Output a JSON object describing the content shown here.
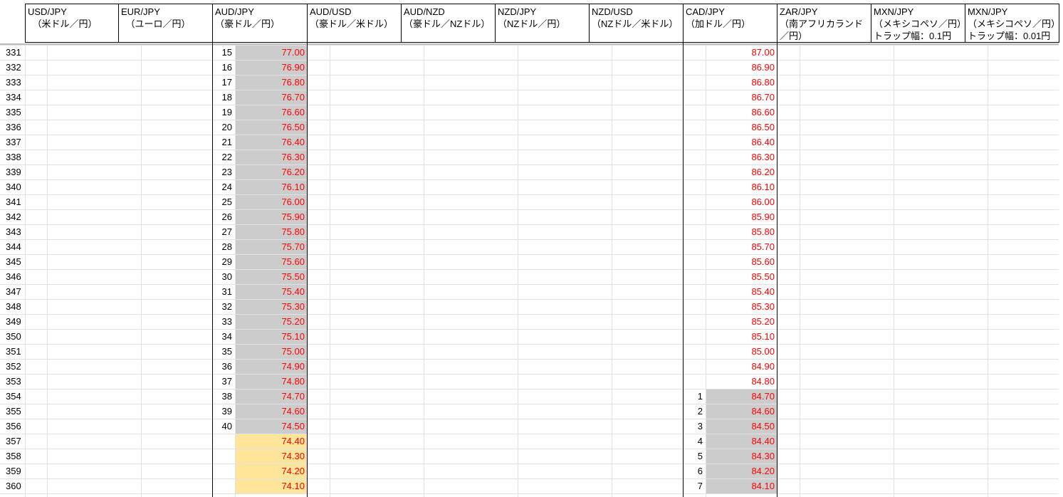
{
  "colors": {
    "price_text": "#ff0000",
    "fill_gray": "#cccccc",
    "fill_yellow": "#ffe599"
  },
  "headers": [
    {
      "line1": "USD/JPY",
      "line2": "　（米ドル／円）",
      "line3": ""
    },
    {
      "line1": "EUR/JPY",
      "line2": "　（ユーロ／円）",
      "line3": ""
    },
    {
      "line1": "AUD/JPY",
      "line2": "（豪ドル／円）",
      "line3": ""
    },
    {
      "line1": "AUD/USD",
      "line2": "（豪ドル／米ドル）",
      "line3": ""
    },
    {
      "line1": "AUD/NZD",
      "line2": "（豪ドル／NZドル）",
      "line3": ""
    },
    {
      "line1": "NZD/JPY",
      "line2": "（NZドル／円）",
      "line3": ""
    },
    {
      "line1": "NZD/USD",
      "line2": "（NZドル／米ドル）",
      "line3": ""
    },
    {
      "line1": "CAD/JPY",
      "line2": "（加ドル／円）",
      "line3": ""
    },
    {
      "line1": "ZAR/JPY",
      "line2": "（南アフリカランド",
      "line3": "／円）"
    },
    {
      "line1": "MXN/JPY",
      "line2": "（メキシコペソ／円）",
      "line3": "トラップ幅：0.1円"
    },
    {
      "line1": "MXN/JPY",
      "line2": "（メキシコペソ／円）",
      "line3": "トラップ幅：0.01円"
    }
  ],
  "rows": [
    {
      "num": "331",
      "aud_idx": "15",
      "aud_price": "77.00",
      "cad_idx": "",
      "cad_price": "87.00"
    },
    {
      "num": "332",
      "aud_idx": "16",
      "aud_price": "76.90",
      "cad_idx": "",
      "cad_price": "86.90"
    },
    {
      "num": "333",
      "aud_idx": "17",
      "aud_price": "76.80",
      "cad_idx": "",
      "cad_price": "86.80"
    },
    {
      "num": "334",
      "aud_idx": "18",
      "aud_price": "76.70",
      "cad_idx": "",
      "cad_price": "86.70"
    },
    {
      "num": "335",
      "aud_idx": "19",
      "aud_price": "76.60",
      "cad_idx": "",
      "cad_price": "86.60"
    },
    {
      "num": "336",
      "aud_idx": "20",
      "aud_price": "76.50",
      "cad_idx": "",
      "cad_price": "86.50"
    },
    {
      "num": "337",
      "aud_idx": "21",
      "aud_price": "76.40",
      "cad_idx": "",
      "cad_price": "86.40"
    },
    {
      "num": "338",
      "aud_idx": "22",
      "aud_price": "76.30",
      "cad_idx": "",
      "cad_price": "86.30"
    },
    {
      "num": "339",
      "aud_idx": "23",
      "aud_price": "76.20",
      "cad_idx": "",
      "cad_price": "86.20"
    },
    {
      "num": "340",
      "aud_idx": "24",
      "aud_price": "76.10",
      "cad_idx": "",
      "cad_price": "86.10"
    },
    {
      "num": "341",
      "aud_idx": "25",
      "aud_price": "76.00",
      "cad_idx": "",
      "cad_price": "86.00"
    },
    {
      "num": "342",
      "aud_idx": "26",
      "aud_price": "75.90",
      "cad_idx": "",
      "cad_price": "85.90"
    },
    {
      "num": "343",
      "aud_idx": "27",
      "aud_price": "75.80",
      "cad_idx": "",
      "cad_price": "85.80"
    },
    {
      "num": "344",
      "aud_idx": "28",
      "aud_price": "75.70",
      "cad_idx": "",
      "cad_price": "85.70"
    },
    {
      "num": "345",
      "aud_idx": "29",
      "aud_price": "75.60",
      "cad_idx": "",
      "cad_price": "85.60"
    },
    {
      "num": "346",
      "aud_idx": "30",
      "aud_price": "75.50",
      "cad_idx": "",
      "cad_price": "85.50"
    },
    {
      "num": "347",
      "aud_idx": "31",
      "aud_price": "75.40",
      "cad_idx": "",
      "cad_price": "85.40"
    },
    {
      "num": "348",
      "aud_idx": "32",
      "aud_price": "75.30",
      "cad_idx": "",
      "cad_price": "85.30"
    },
    {
      "num": "349",
      "aud_idx": "33",
      "aud_price": "75.20",
      "cad_idx": "",
      "cad_price": "85.20"
    },
    {
      "num": "350",
      "aud_idx": "34",
      "aud_price": "75.10",
      "cad_idx": "",
      "cad_price": "85.10"
    },
    {
      "num": "351",
      "aud_idx": "35",
      "aud_price": "75.00",
      "cad_idx": "",
      "cad_price": "85.00"
    },
    {
      "num": "352",
      "aud_idx": "36",
      "aud_price": "74.90",
      "cad_idx": "",
      "cad_price": "84.90"
    },
    {
      "num": "353",
      "aud_idx": "37",
      "aud_price": "74.80",
      "cad_idx": "",
      "cad_price": "84.80"
    },
    {
      "num": "354",
      "aud_idx": "38",
      "aud_price": "74.70",
      "cad_idx": "1",
      "cad_price": "84.70"
    },
    {
      "num": "355",
      "aud_idx": "39",
      "aud_price": "74.60",
      "cad_idx": "2",
      "cad_price": "84.60"
    },
    {
      "num": "356",
      "aud_idx": "40",
      "aud_price": "74.50",
      "cad_idx": "3",
      "cad_price": "84.50"
    },
    {
      "num": "357",
      "aud_idx": "",
      "aud_price": "74.40",
      "cad_idx": "4",
      "cad_price": "84.40"
    },
    {
      "num": "358",
      "aud_idx": "",
      "aud_price": "74.30",
      "cad_idx": "5",
      "cad_price": "84.30"
    },
    {
      "num": "359",
      "aud_idx": "",
      "aud_price": "74.20",
      "cad_idx": "6",
      "cad_price": "84.20"
    },
    {
      "num": "360",
      "aud_idx": "",
      "aud_price": "74.10",
      "cad_idx": "7",
      "cad_price": "84.10"
    }
  ]
}
